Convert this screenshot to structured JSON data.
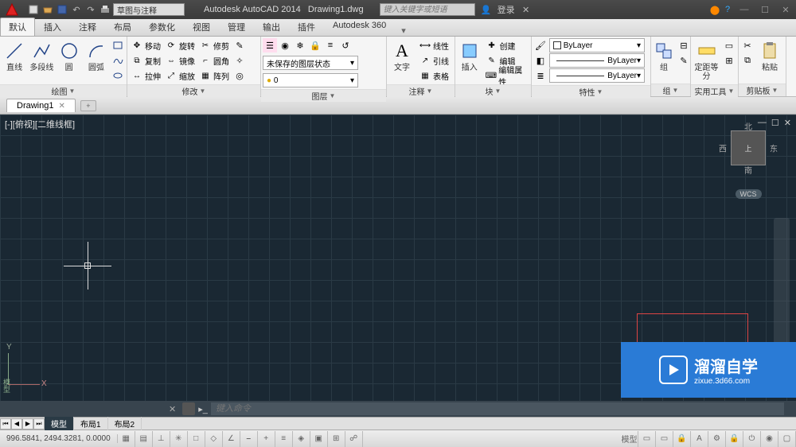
{
  "app": {
    "title": "Autodesk AutoCAD 2014",
    "file": "Drawing1.dwg"
  },
  "search_placeholder": "键入关键字或短语",
  "workspace": "草图与注释",
  "login_label": "登录",
  "tabs": {
    "items": [
      {
        "label": "默认"
      },
      {
        "label": "插入"
      },
      {
        "label": "注释"
      },
      {
        "label": "布局"
      },
      {
        "label": "参数化"
      },
      {
        "label": "视图"
      },
      {
        "label": "管理"
      },
      {
        "label": "输出"
      },
      {
        "label": "插件"
      },
      {
        "label": "Autodesk 360"
      }
    ],
    "active": 0
  },
  "ribbon": {
    "draw": {
      "title": "绘图",
      "line": "直线",
      "polyline": "多段线",
      "circle": "圆",
      "arc": "圆弧"
    },
    "modify": {
      "title": "修改",
      "move": "移动",
      "rotate": "旋转",
      "trim": "修剪",
      "copy": "复制",
      "mirror": "镜像",
      "fillet": "圆角",
      "stretch": "拉伸",
      "scale": "缩放",
      "array": "阵列"
    },
    "layers": {
      "title": "图层",
      "state": "未保存的图层状态"
    },
    "annotation": {
      "title": "注释",
      "text": "文字",
      "linear": "线性",
      "leader": "引线",
      "table": "表格"
    },
    "block": {
      "title": "块",
      "insert": "插入",
      "create": "创建",
      "edit": "编辑",
      "editattr": "编辑属性"
    },
    "properties": {
      "title": "特性",
      "bylayer": "ByLayer"
    },
    "group": {
      "title": "组",
      "group": "组"
    },
    "utilities": {
      "title": "实用工具",
      "measure": "定距等分"
    },
    "clipboard": {
      "title": "剪贴板",
      "paste": "粘贴"
    }
  },
  "filetab": {
    "name": "Drawing1"
  },
  "viewport": {
    "label": "[-][俯视][二维线框]",
    "wcs": "WCS",
    "cube": {
      "top": "上",
      "n": "北",
      "s": "南",
      "e": "东",
      "w": "西"
    }
  },
  "command": {
    "placeholder": "键入命令"
  },
  "layouts": {
    "model": "模型",
    "layout1": "布局1",
    "layout2": "布局2"
  },
  "status": {
    "coords": "996.5841, 2494.3281, 0.0000"
  },
  "ucs": {
    "x": "X",
    "y": "Y"
  },
  "watermark": {
    "title": "溜溜自学",
    "url": "zixue.3d66.com"
  },
  "model_sidebar": "模型"
}
